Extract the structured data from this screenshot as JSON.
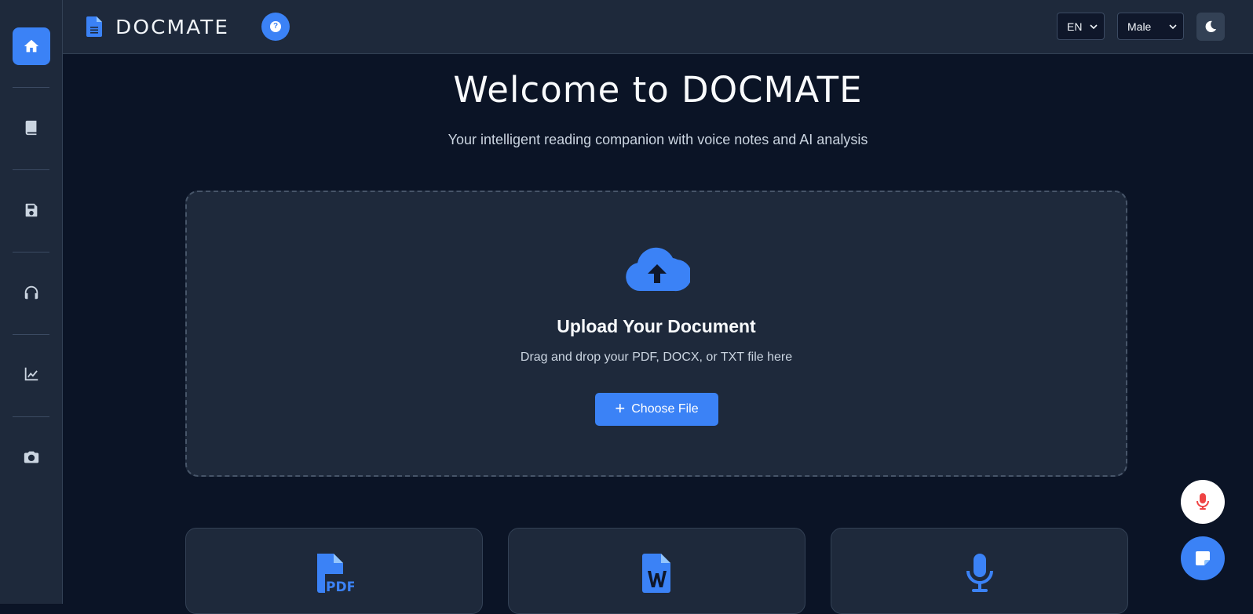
{
  "app": {
    "name": "DOCMATE"
  },
  "sidebar": {
    "items": [
      {
        "id": "home",
        "icon": "home-icon",
        "active": true
      },
      {
        "id": "library",
        "icon": "book-icon",
        "active": false
      },
      {
        "id": "saved",
        "icon": "floppy-disk-icon",
        "active": false
      },
      {
        "id": "audio",
        "icon": "headphones-icon",
        "active": false
      },
      {
        "id": "analytics",
        "icon": "chart-line-icon",
        "active": false
      },
      {
        "id": "camera",
        "icon": "camera-icon",
        "active": false
      }
    ]
  },
  "header": {
    "language": {
      "selected": "EN"
    },
    "voice": {
      "selected": "Male"
    },
    "theme_icon": "moon-icon"
  },
  "hero": {
    "title": "Welcome to DOCMATE",
    "subtitle": "Your intelligent reading companion with voice notes and AI analysis"
  },
  "upload": {
    "title": "Upload Your Document",
    "description": "Drag and drop your PDF, DOCX, or TXT file here",
    "button_label": "Choose File",
    "icon": "cloud-upload-icon"
  },
  "features": [
    {
      "icon": "file-pdf-icon"
    },
    {
      "icon": "file-word-icon"
    },
    {
      "icon": "microphone-icon"
    }
  ],
  "floating": {
    "mic_icon": "microphone-icon",
    "note_icon": "sticky-note-icon"
  },
  "colors": {
    "accent": "#3b82f6",
    "background": "#0b1426",
    "surface": "#1e293b",
    "mic_red": "#ef4444"
  }
}
